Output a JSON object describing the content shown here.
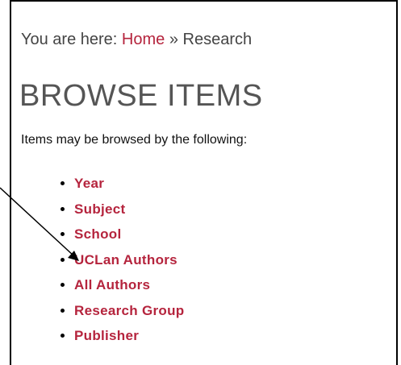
{
  "breadcrumb": {
    "prefix": "You are here:",
    "home_label": "Home",
    "separator": "»",
    "current": "Research"
  },
  "heading": "BROWSE ITEMS",
  "intro": "Items may be browsed by the following:",
  "browse_links": [
    "Year",
    "Subject",
    "School",
    "UCLan Authors",
    "All Authors",
    "Research Group",
    "Publisher"
  ],
  "colors": {
    "link": "#b5243d",
    "heading": "#555555",
    "text": "#444444"
  }
}
